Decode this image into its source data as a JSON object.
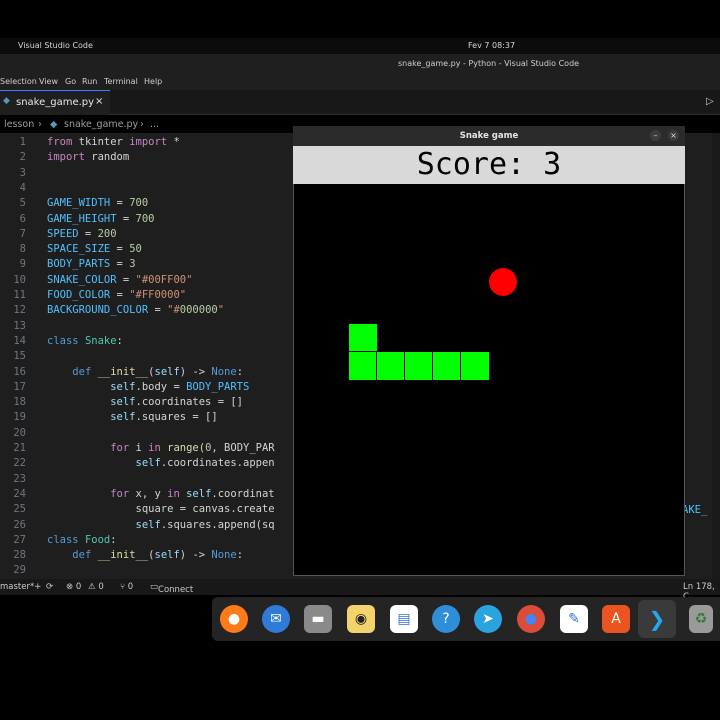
{
  "system": {
    "app_name": "Visual Studio Code",
    "clock": "Fev 7  08:37"
  },
  "window_title": "snake_game.py - Python - Visual Studio Code",
  "menu": [
    "Selection",
    "View",
    "Go",
    "Run",
    "Terminal",
    "Help"
  ],
  "tab": {
    "label": "snake_game.py",
    "close": "×"
  },
  "breadcrumb": {
    "folder": "lesson",
    "file": "snake_game.py",
    "more": "..."
  },
  "editor": {
    "line_numbers": [
      "1",
      "2",
      "3",
      "4",
      "5",
      "6",
      "7",
      "8",
      "9",
      "10",
      "11",
      "12",
      "13",
      "14",
      "15",
      "16",
      "17",
      "18",
      "19",
      "20",
      "21",
      "22",
      "23",
      "24",
      "25",
      "26",
      "27",
      "28",
      "29"
    ],
    "lines": [
      "from tkinter import *",
      "import random",
      "",
      "",
      "GAME_WIDTH = 700",
      "GAME_HEIGHT = 700",
      "SPEED = 200",
      "SPACE_SIZE = 50",
      "BODY_PARTS = 3",
      "SNAKE_COLOR = \"#00FF00\"",
      "FOOD_COLOR = \"#FF0000\"",
      "BACKGROUND_COLOR = \"#000000\"",
      "",
      "class Snake:",
      "",
      "    def __init__(self) -> None:",
      "          self.body = BODY_PARTS",
      "          self.coordinates = []",
      "          self.squares = []",
      "",
      "          for i in range(0, BODY_PAR",
      "              self.coordinates.appen",
      "",
      "          for x, y in self.coordinat",
      "              square = canvas.create",
      "              self.squares.append(sq",
      "class Food:",
      "    def __init__(self) -> None:",
      ""
    ],
    "right_fragment": "AKE_"
  },
  "status": {
    "branch": "master*+",
    "sync": "⟳",
    "errors": "⊗ 0",
    "warnings": "⚠ 0",
    "ports": "⑂ 0",
    "connect": "Connect",
    "position": "Ln 178, C"
  },
  "dock": {
    "apps": [
      "firefox-icon",
      "thunderbird-icon",
      "files-icon",
      "rhythmbox-icon",
      "writer-icon",
      "help-icon",
      "telegram-icon",
      "chrome-icon",
      "text-editor-icon",
      "app-center-icon",
      "vscode-icon",
      "trash-icon"
    ]
  },
  "snake_window": {
    "title": "Snake game",
    "score_text": "Score: 3",
    "colors": {
      "snake": "#00FF00",
      "food": "#FF0000",
      "background": "#000000"
    },
    "snake_cells": [
      [
        2,
        5
      ],
      [
        2,
        6
      ],
      [
        3,
        6
      ],
      [
        4,
        6
      ],
      [
        5,
        6
      ],
      [
        6,
        6
      ]
    ],
    "food_cell": [
      7,
      3
    ],
    "grid_size": 14
  }
}
